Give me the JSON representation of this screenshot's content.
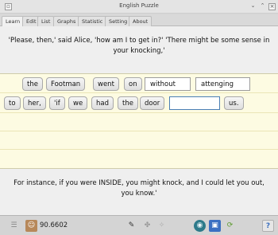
{
  "window": {
    "title": "English Puzzle"
  },
  "tabs": [
    "Learn",
    "Edit",
    "List",
    "Graphs",
    "Statistic",
    "Setting",
    "About"
  ],
  "quote_top": "'Please, then,' said Alice, 'how am I to get in?' 'There might be some sense in your knocking,'",
  "row1": {
    "words": [
      "the",
      "Footman",
      "went",
      "on"
    ],
    "slots": [
      "without",
      "attenging"
    ]
  },
  "row2": {
    "words": [
      "to",
      "her,",
      "'if",
      "we",
      "had",
      "the",
      "door"
    ],
    "slot_active": "",
    "after": "us."
  },
  "quote_bottom": "For instance, if you were INSIDE, you might knock, and I could let you out, you know.'",
  "status": {
    "score": "90.6602",
    "icons": [
      "menu-icon",
      "face-icon",
      "pen-icon",
      "puzzle-icon",
      "wand-icon",
      "refresh-icon",
      "image-icon",
      "cycle-icon",
      "help-icon"
    ],
    "help": "?"
  }
}
